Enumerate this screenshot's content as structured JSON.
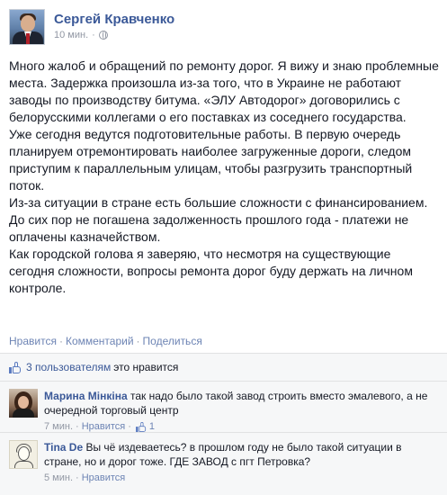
{
  "post": {
    "author": "Сергей Кравченко",
    "time": "10 мин.",
    "dot": "·",
    "paragraphs": [
      "Много жалоб и обращений по ремонту дорог. Я вижу и знаю проблемные места. Задержка произошла из-за того, что в Украине не работают заводы по производству битума. «ЭЛУ Автодорог» договорились с белорусскими коллегами о его поставках из соседнего государства.",
      "Уже сегодня ведутся подготовительные работы. В первую очередь планируем отремонтировать наиболее загруженные дороги, следом приступим к параллельным улицам, чтобы разгрузить транспортный поток.",
      "Из-за ситуации в стране есть большие сложности с финансированием. До сих пор не погашена задолженность прошлого года - платежи не оплачены казначейством.",
      "Как городской голова я заверяю, что несмотря на существующие сегодня сложности, вопросы ремонта дорог буду держать на личном контроле."
    ]
  },
  "actions": {
    "like": "Нравится",
    "comment": "Комментарий",
    "share": "Поделиться",
    "sep": "·"
  },
  "likes": {
    "count_text": "3 пользователям",
    "suffix": "это нравится"
  },
  "comments": [
    {
      "name": "Марина Мінкіна",
      "text": "так надо было такой завод строить вместо эмалевого, а не очередной торговый центр",
      "time": "7 мин.",
      "dot": "·",
      "like": "Нравится",
      "like_count": "1"
    },
    {
      "name": "Tina De",
      "text": "Вы чё издеваетесь? в прошлом году не было такой ситуации в стране, но и дорог тоже. ГДЕ ЗАВОД с пгт Петровка?",
      "time": "5 мин.",
      "dot": "·",
      "like": "Нравится"
    }
  ],
  "colors": {
    "link": "#3b5998",
    "meta": "#9197a3",
    "ufi_bg": "#f6f7f8"
  },
  "icons": {
    "privacy": "globe-icon",
    "like": "thumbs-up-icon"
  }
}
